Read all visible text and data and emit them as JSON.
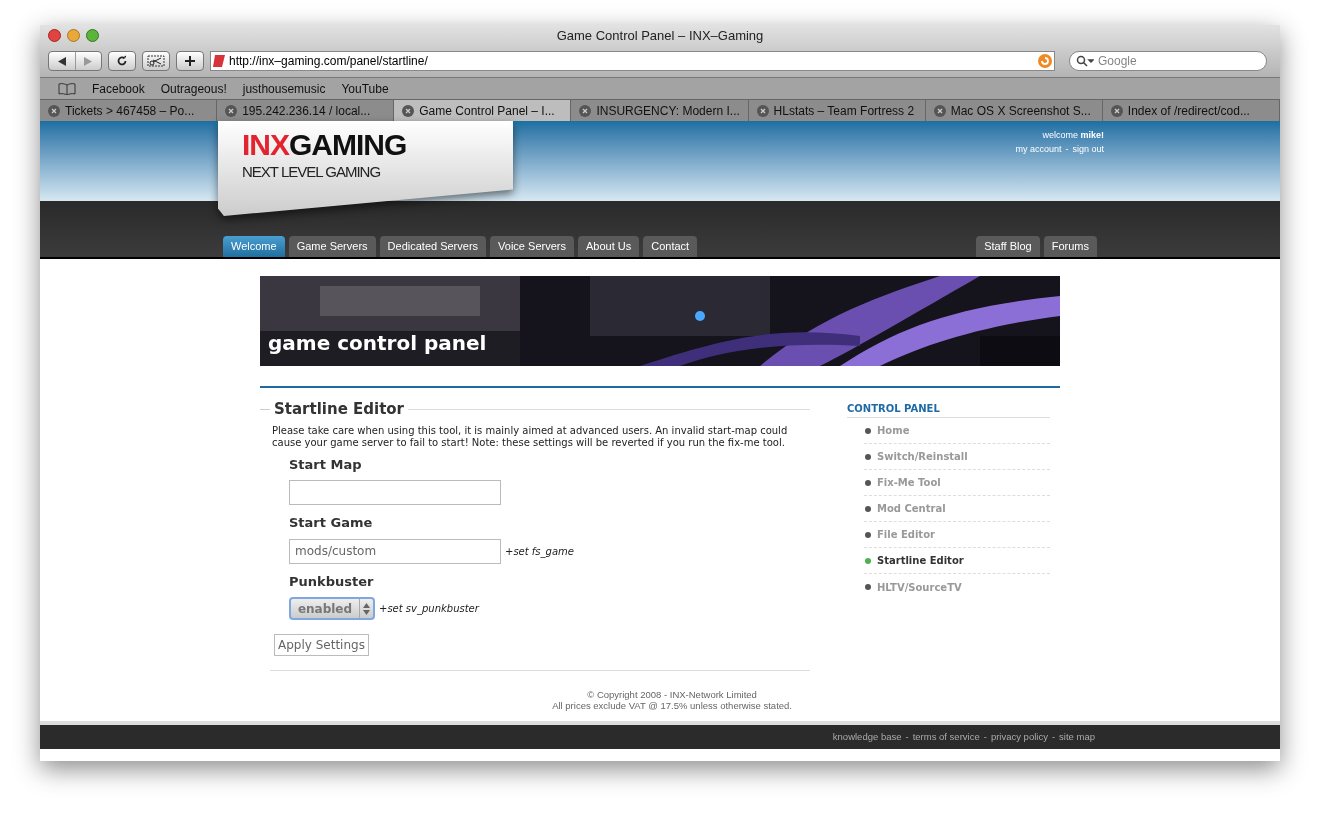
{
  "window": {
    "title": "Game Control Panel – INX–Gaming"
  },
  "toolbar": {
    "url": "http://inx–gaming.com/panel/startline/",
    "search_placeholder": "Google"
  },
  "bookmarks": [
    "Facebook",
    "Outrageous!",
    "justhousemusic",
    "YouTube"
  ],
  "tabs": [
    {
      "label": "Tickets > 467458 – Po...",
      "selected": false
    },
    {
      "label": "195.242.236.14 / local...",
      "selected": false
    },
    {
      "label": "Game Control Panel – I...",
      "selected": true
    },
    {
      "label": "INSURGENCY: Modern I...",
      "selected": false
    },
    {
      "label": "HLstats – Team Fortress 2",
      "selected": false
    },
    {
      "label": "Mac OS X Screenshot S...",
      "selected": false
    },
    {
      "label": "Index of /redirect/cod...",
      "selected": false
    }
  ],
  "header": {
    "logo_accent": "INX",
    "logo_rest": "GAMING",
    "tagline": "NEXT LEVEL GAMING",
    "welcome": "welcome **mike!**",
    "account_links": [
      "my account",
      "sign out"
    ],
    "separator": "-"
  },
  "nav": {
    "left": [
      {
        "label": "Welcome",
        "selected": true
      },
      {
        "label": "Game Servers",
        "selected": false
      },
      {
        "label": "Dedicated Servers",
        "selected": false
      },
      {
        "label": "Voice Servers",
        "selected": false
      },
      {
        "label": "About Us",
        "selected": false
      },
      {
        "label": "Contact",
        "selected": false
      }
    ],
    "right": [
      {
        "label": "Staff Blog",
        "selected": false
      },
      {
        "label": "Forums",
        "selected": false
      }
    ]
  },
  "banner": {
    "title": "game control panel"
  },
  "form": {
    "title": "Startline Editor",
    "description": "Please take care when using this tool, it is mainly aimed at advanced users. An invalid start-map could cause your game server to fail to start! Note: these settings will be reverted if you run the fix-me tool.",
    "fields": [
      {
        "kind": "text",
        "label": "Start Map"
      },
      {
        "kind": "text",
        "label": "Start Game",
        "value": "mods/custom",
        "note": "+set fs_game"
      },
      {
        "kind": "select",
        "label": "Punkbuster",
        "value": "enabled",
        "note": "+set sv_punkbuster"
      }
    ],
    "submit": "Apply Settings"
  },
  "sidebar": {
    "heading": "CONTROL PANEL",
    "items": [
      {
        "label": "Home",
        "selected": false
      },
      {
        "label": "Switch/Reinstall",
        "selected": false
      },
      {
        "label": "Fix-Me Tool",
        "selected": false
      },
      {
        "label": "Mod Central",
        "selected": false
      },
      {
        "label": "File Editor",
        "selected": false
      },
      {
        "label": "Startline Editor",
        "selected": true
      },
      {
        "label": "HLTV/SourceTV",
        "selected": false
      }
    ]
  },
  "copyright": [
    "© Copyright 2008 - INX-Network Limited",
    "All prices exclude VAT @ 17.5% unless otherwise stated."
  ],
  "footer_links": [
    "knowledge base",
    "terms of service",
    "privacy policy",
    "site map"
  ]
}
